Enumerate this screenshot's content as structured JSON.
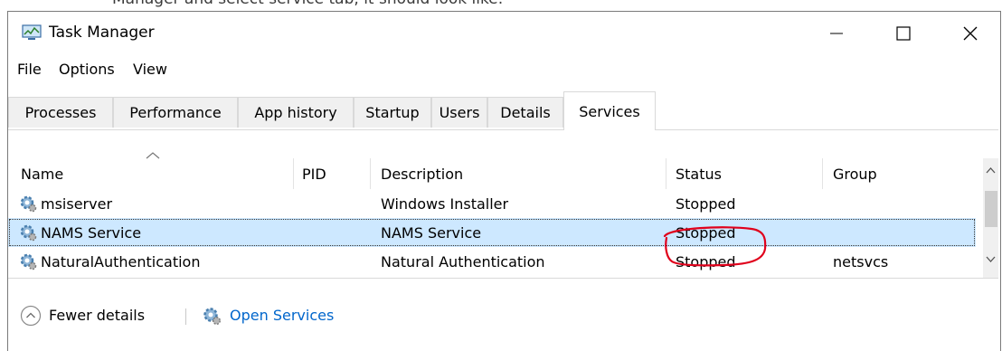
{
  "caption": "Manager and select service tab, it should look like:",
  "window": {
    "title": "Task Manager",
    "icons": {
      "app": "task-manager-icon",
      "minimize": "minimize-icon",
      "maximize": "maximize-icon",
      "close": "close-icon"
    }
  },
  "menu": [
    "File",
    "Options",
    "View"
  ],
  "tabs": [
    "Processes",
    "Performance",
    "App history",
    "Startup",
    "Users",
    "Details",
    "Services"
  ],
  "active_tab": "Services",
  "columns": [
    "Name",
    "PID",
    "Description",
    "Status",
    "Group"
  ],
  "rows": [
    {
      "name": "msiserver",
      "pid": "",
      "description": "Windows Installer",
      "status": "Stopped",
      "group": ""
    },
    {
      "name": "NAMS Service",
      "pid": "",
      "description": "NAMS Service",
      "status": "Stopped",
      "group": ""
    },
    {
      "name": "NaturalAuthentication",
      "pid": "",
      "description": "Natural Authentication",
      "status": "Stopped",
      "group": "netsvcs"
    }
  ],
  "selected_row": 1,
  "footer": {
    "fewer_details": "Fewer details",
    "open_services": "Open Services"
  },
  "colors": {
    "selection": "#cde8ff",
    "link": "#0066cc",
    "annotation": "#e0001b"
  }
}
